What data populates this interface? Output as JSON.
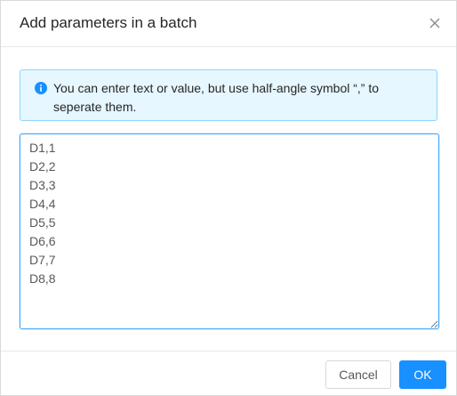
{
  "dialog": {
    "title": "Add parameters in a batch",
    "close_icon": "close-icon"
  },
  "alert": {
    "icon": "info-circle-icon",
    "message": "You can enter text or value, but use half-angle symbol “,”  to seperate them."
  },
  "textarea": {
    "value": "D1,1\nD2,2\nD3,3\nD4,4\nD5,5\nD6,6\nD7,7\nD8,8"
  },
  "footer": {
    "cancel_label": "Cancel",
    "ok_label": "OK"
  },
  "colors": {
    "primary": "#1890ff",
    "alert_bg": "#e6f7ff",
    "alert_border": "#91d5ff"
  }
}
